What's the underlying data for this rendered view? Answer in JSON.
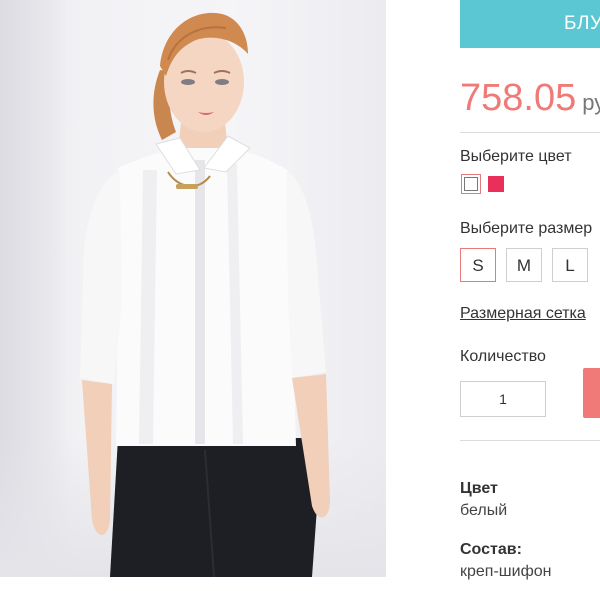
{
  "product_image": {
    "alt": "Белая блуза"
  },
  "category_banner": {
    "label": "БЛУ"
  },
  "price": {
    "value": "758.05",
    "currency": "ру"
  },
  "color_selector": {
    "label": "Выберите цвет",
    "options": [
      {
        "name": "white",
        "color": "#ffffff",
        "selected": true
      },
      {
        "name": "red",
        "color": "#e8305a",
        "selected": false
      }
    ]
  },
  "size_selector": {
    "label": "Выберите размер",
    "options": [
      "S",
      "M",
      "L"
    ],
    "selected": "S"
  },
  "size_chart_link": "Размерная сетка",
  "quantity": {
    "label": "Количество",
    "value": "1"
  },
  "attributes": [
    {
      "title": "Цвет",
      "value": "белый"
    },
    {
      "title": "Состав:",
      "value": "креп-шифон"
    }
  ],
  "colors": {
    "accent": "#5bc7d3",
    "price": "#f07a78",
    "selected_border": "#e57a7a"
  }
}
